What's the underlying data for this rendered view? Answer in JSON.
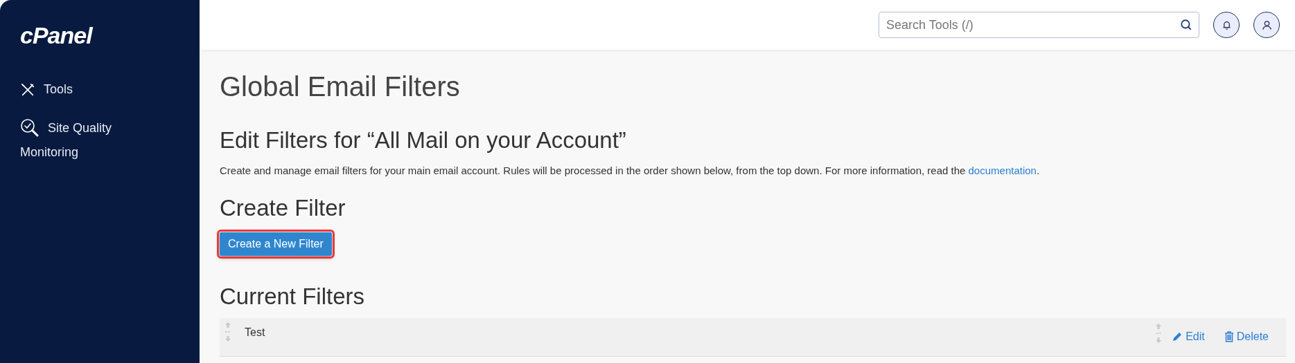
{
  "sidebar": {
    "logo": "cPanel",
    "items": [
      {
        "kind": "tools",
        "label": "Tools"
      },
      {
        "kind": "quality",
        "label": "Site Quality",
        "label_line2": "Monitoring"
      }
    ]
  },
  "header": {
    "search": {
      "placeholder": "Search Tools (/)"
    }
  },
  "page": {
    "title": "Global Email Filters",
    "subtitle": "Edit Filters for “All Mail on your Account”",
    "description": "Create and manage email filters for your main email account. Rules will be processed in the order shown below, from the top down. For more information, read the ",
    "description_link": "documentation",
    "description_end": ".",
    "create_heading": "Create Filter",
    "create_button": {
      "label": "Create a New Filter",
      "highlighted": true
    },
    "current_heading": "Current Filters",
    "filters": [
      {
        "name": "Test",
        "edit": "Edit",
        "delete": "Delete"
      }
    ]
  }
}
